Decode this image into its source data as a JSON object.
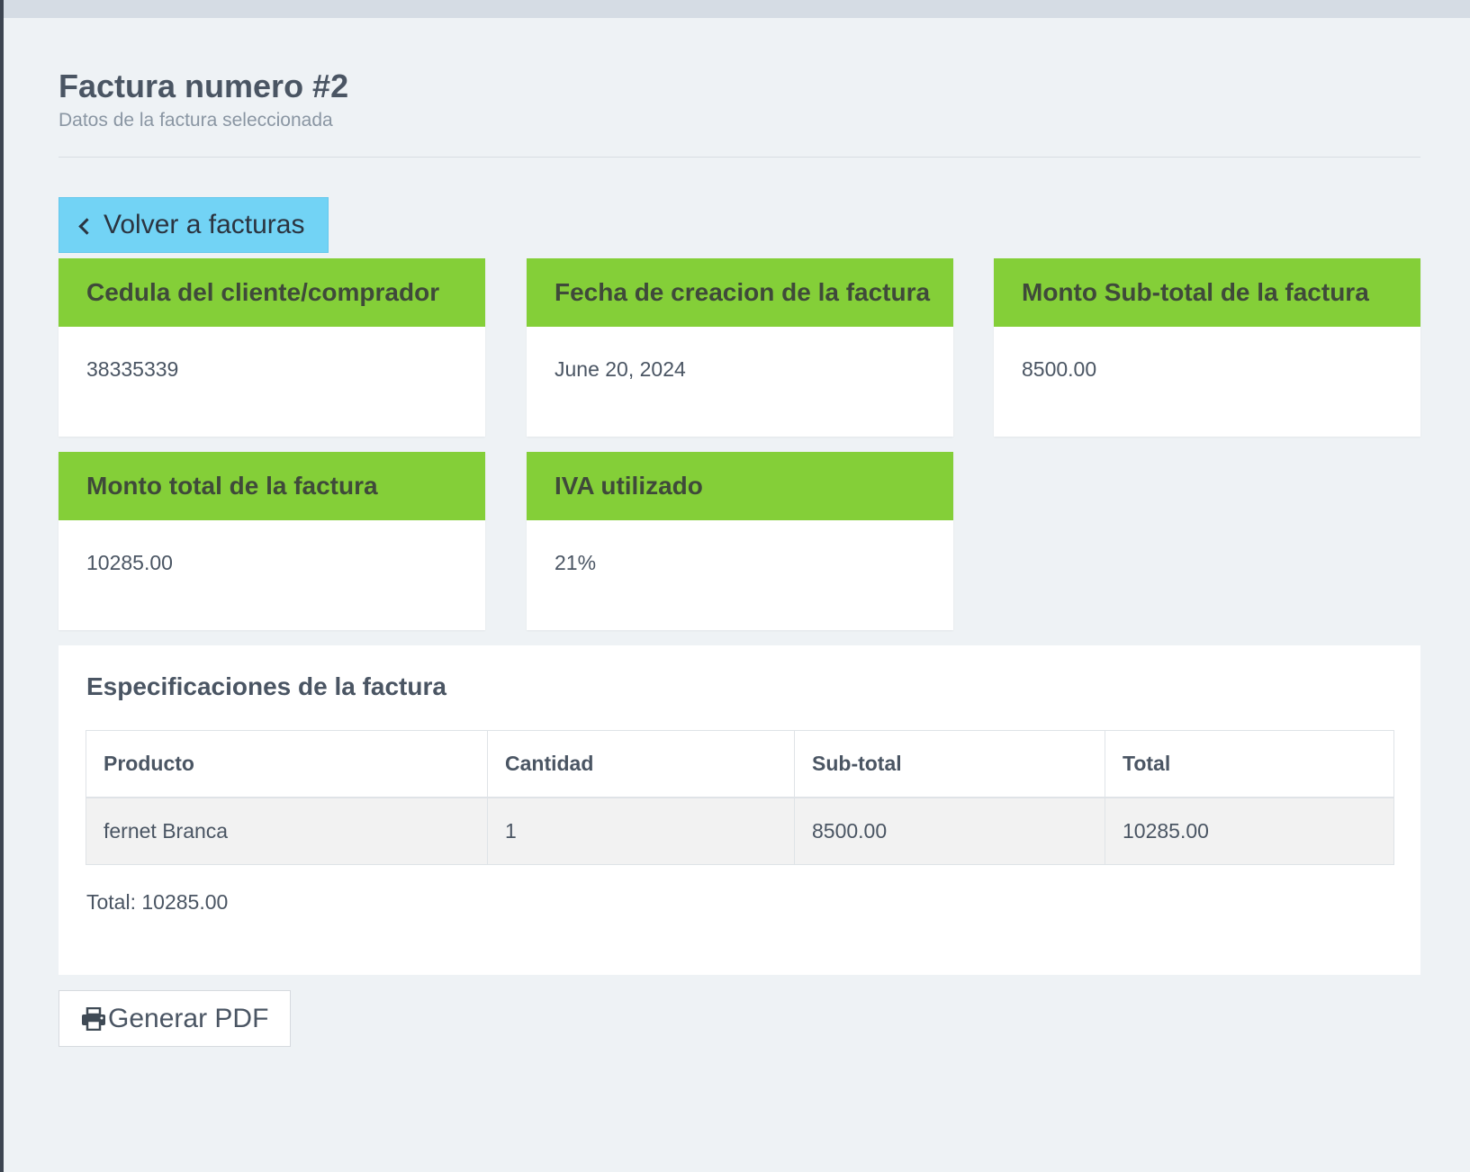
{
  "header": {
    "title": "Factura numero #2",
    "subtitle": "Datos de la factura seleccionada"
  },
  "back_button": {
    "label": "Volver a facturas",
    "icon": "chevron-left-icon"
  },
  "cards": [
    {
      "title": "Cedula del cliente/comprador",
      "value": "38335339"
    },
    {
      "title": "Fecha de creacion de la factura",
      "value": "June 20, 2024"
    },
    {
      "title": "Monto Sub-total de la factura",
      "value": "8500.00"
    },
    {
      "title": "Monto total de la factura",
      "value": "10285.00"
    },
    {
      "title": "IVA utilizado",
      "value": "21%"
    }
  ],
  "specs": {
    "title": "Especificaciones de la factura",
    "columns": [
      "Producto",
      "Cantidad",
      "Sub-total",
      "Total"
    ],
    "rows": [
      [
        "fernet Branca",
        "1",
        "8500.00",
        "10285.00"
      ]
    ],
    "total_text": "Total: 10285.00"
  },
  "pdf_button": {
    "label": "Generar PDF",
    "icon": "printer-icon"
  },
  "colors": {
    "background": "#eef2f5",
    "card_header": "#84cf38",
    "back_button": "#72d3f5",
    "text": "#4a5563"
  }
}
